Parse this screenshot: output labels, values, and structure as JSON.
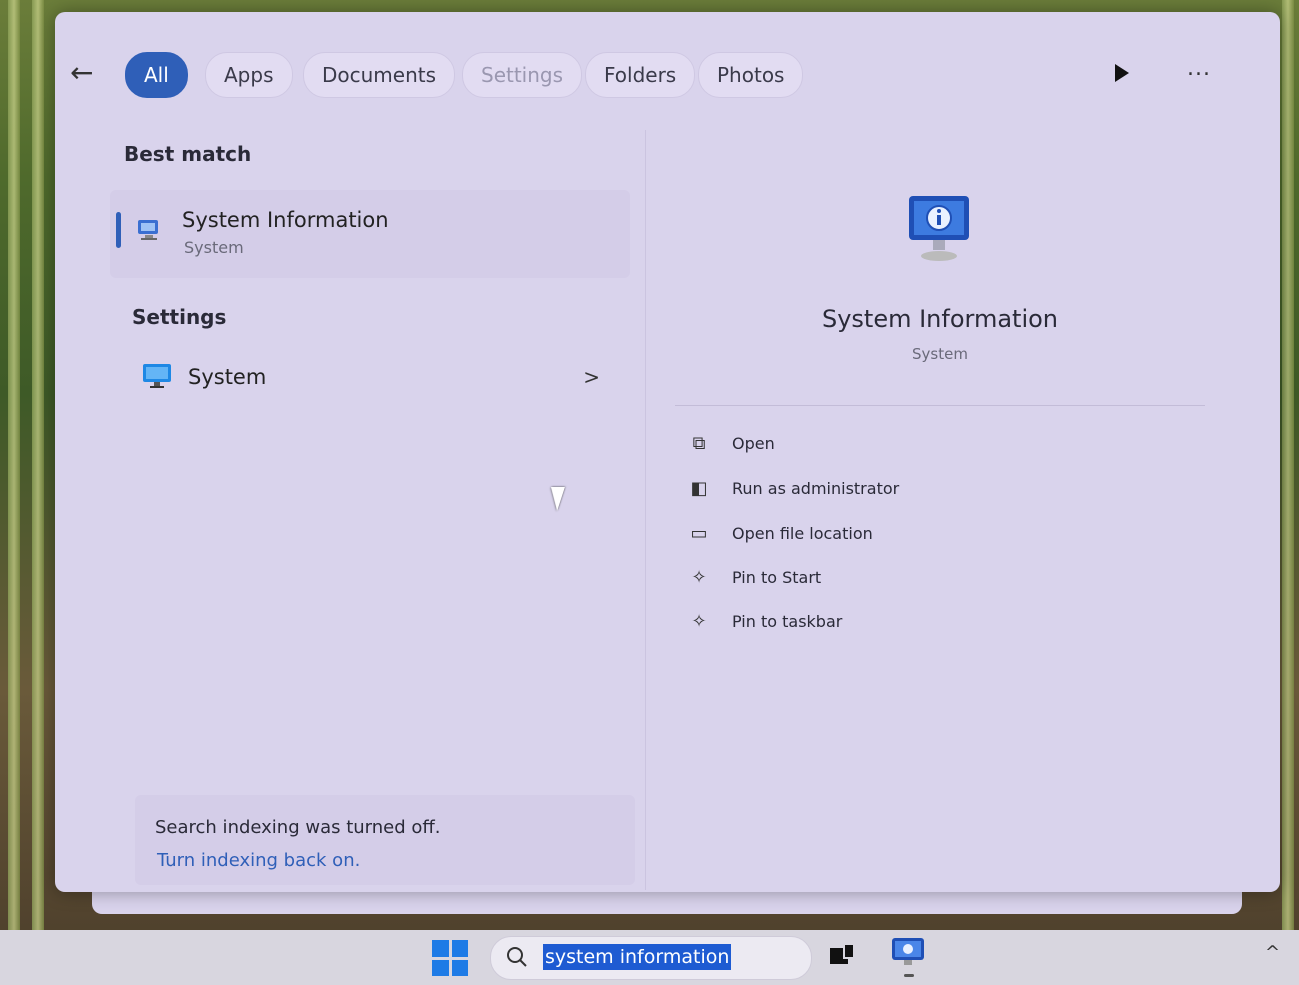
{
  "filters": {
    "all": "All",
    "apps": "Apps",
    "documents": "Documents",
    "settings": "Settings",
    "folders": "Folders",
    "photos": "Photos",
    "more": "..."
  },
  "left": {
    "best_match_title": "Best match",
    "best_match": {
      "title": "System Information",
      "subtitle": "System"
    },
    "settings_title": "Settings",
    "settings_item": {
      "label": "System",
      "chevron": ">"
    },
    "indexing": {
      "message": "Search indexing was turned off.",
      "link": "Turn indexing back on."
    }
  },
  "right": {
    "app_title": "System Information",
    "app_subtitle": "System",
    "actions": [
      {
        "label": "Open",
        "icon": "open-external-icon"
      },
      {
        "label": "Run as administrator",
        "icon": "admin-shield-icon"
      },
      {
        "label": "Open file location",
        "icon": "folder-icon"
      },
      {
        "label": "Pin to Start",
        "icon": "pin-icon"
      },
      {
        "label": "Pin to taskbar",
        "icon": "pin-icon"
      }
    ]
  },
  "taskbar": {
    "search_text": "system information",
    "tray_chevron": "^"
  },
  "colors": {
    "accent": "#2f5fb8",
    "panel": "#d9d3ec",
    "taskbar": "#d8d6df"
  }
}
